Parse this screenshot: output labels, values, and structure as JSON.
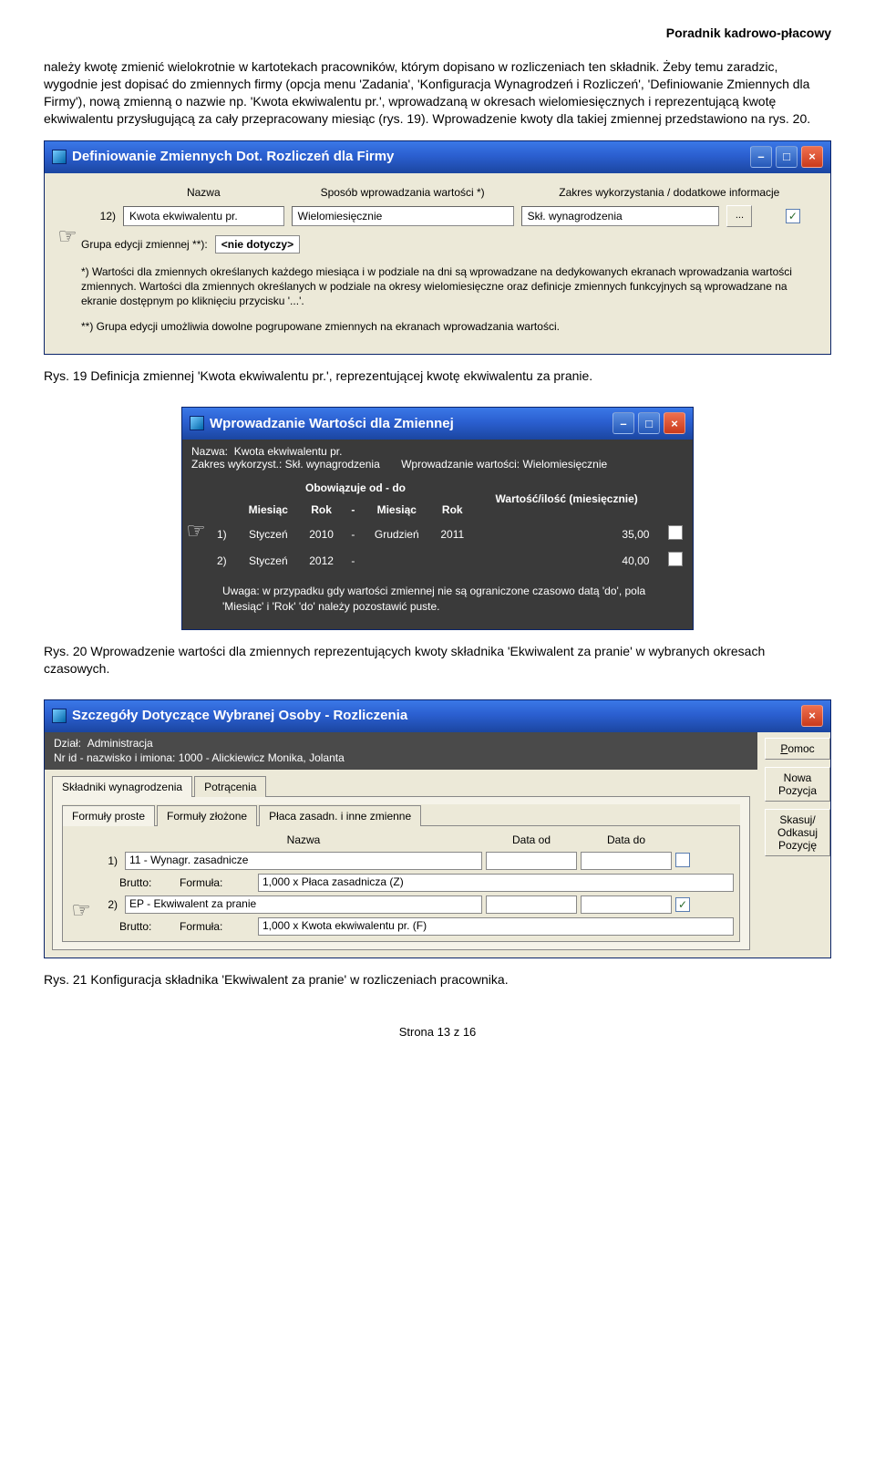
{
  "header": "Poradnik kadrowo-płacowy",
  "intro": "należy kwotę zmienić wielokrotnie w kartotekach pracowników, którym dopisano w rozliczeniach ten składnik. Żeby temu zaradzic, wygodnie jest dopisać do zmiennych firmy (opcja menu 'Zadania', 'Konfiguracja Wynagrodzeń i Rozliczeń', 'Definiowanie Zmiennych dla Firmy'), nową zmienną o nazwie np. 'Kwota ekwiwalentu pr.', wprowadzaną w okresach wielomiesięcznych i reprezentującą kwotę ekwiwalentu przysługującą za cały przepracowany miesiąc (rys. 19). Wprowadzenie kwoty dla takiej zmiennej przedstawiono na rys. 20.",
  "fig1": {
    "title": "Definiowanie Zmiennych Dot. Rozliczeń dla Firmy",
    "col_name": "Nazwa",
    "col_mode": "Sposób wprowadzania wartości *)",
    "col_scope": "Zakres wykorzystania / dodatkowe informacje",
    "row_idx": "12)",
    "row_name": "Kwota ekwiwalentu pr.",
    "row_mode": "Wielomiesięcznie",
    "row_scope": "Skł. wynagrodzenia",
    "row_btn": "...",
    "group_label": "Grupa edycji zmiennej **):",
    "group_value": "<nie dotyczy>",
    "note1": "*) Wartości dla zmiennych określanych każdego miesiąca i w podziale na dni są wprowadzane na dedykowanych ekranach wprowadzania wartości zmiennych. Wartości dla zmiennych określanych w podziale na okresy wielomiesięczne oraz definicje zmiennych funkcyjnych są wprowadzane na ekranie dostępnym po kliknięciu przycisku '...'.",
    "note2": "**) Grupa edycji umożliwia dowolne pogrupowane zmiennych na ekranach wprowadzania wartości."
  },
  "caption1": "Rys. 19 Definicja zmiennej 'Kwota ekwiwalentu pr.', reprezentującej kwotę ekwiwalentu za pranie.",
  "fig2": {
    "title": "Wprowadzanie Wartości dla Zmiennej",
    "name_label": "Nazwa:",
    "name_value": "Kwota ekwiwalentu pr.",
    "scope_label": "Zakres wykorzyst.: Skł. wynagrodzenia",
    "mode_label": "Wprowadzanie wartości: Wielomiesięcznie",
    "h_from": "Obowiązuje od - do",
    "h_mies1": "Miesiąc",
    "h_rok1": "Rok",
    "h_sep": "-",
    "h_mies2": "Miesiąc",
    "h_rok2": "Rok",
    "h_val": "Wartość/ilość (miesięcznie)",
    "r1_idx": "1)",
    "r1_m1": "Styczeń",
    "r1_y1": "2010",
    "r1_sep": "-",
    "r1_m2": "Grudzień",
    "r1_y2": "2011",
    "r1_val": "35,00",
    "r2_idx": "2)",
    "r2_m1": "Styczeń",
    "r2_y1": "2012",
    "r2_sep": "-",
    "r2_m2": "",
    "r2_y2": "",
    "r2_val": "40,00",
    "note": "Uwaga: w przypadku gdy wartości zmiennej nie są ograniczone czasowo datą 'do', pola 'Miesiąc' i 'Rok' 'do' należy pozostawić puste."
  },
  "caption2": "Rys. 20 Wprowadzenie wartości dla zmiennych reprezentujących kwoty składnika 'Ekwiwalent za pranie' w wybranych okresach czasowych.",
  "fig3": {
    "title": "Szczegóły Dotyczące Wybranej Osoby - Rozliczenia",
    "dept_label": "Dział:",
    "dept_value": "Administracja",
    "id_label": "Nr id - nazwisko i imiona: 1000 - Alickiewicz Monika, Jolanta",
    "tab_skladniki": "Składniki wynagrodzenia",
    "tab_potracenia": "Potrącenia",
    "subtab_proste": "Formuły proste",
    "subtab_zlozone": "Formuły złożone",
    "subtab_placa": "Płaca zasadn. i inne zmienne",
    "col_nazwa": "Nazwa",
    "col_dataod": "Data od",
    "col_datado": "Data do",
    "r1_idx": "1)",
    "r1_name": "11 - Wynagr. zasadnicze",
    "r1_brutto": "Brutto:",
    "r1_formula_lbl": "Formuła:",
    "r1_formula": "1,000 x Płaca zasadnicza (Z)",
    "r2_idx": "2)",
    "r2_name": "EP - Ekwiwalent za pranie",
    "r2_brutto": "Brutto:",
    "r2_formula_lbl": "Formuła:",
    "r2_formula": "1,000 x Kwota ekwiwalentu pr. (F)",
    "btn_pomoc": "Pomoc",
    "btn_nowa": "Nowa Pozycja",
    "btn_skasuj": "Skasuj/ Odkasuj Pozycję"
  },
  "caption3": "Rys. 21 Konfiguracja składnika 'Ekwiwalent za pranie' w rozliczeniach pracownika.",
  "footer": "Strona 13 z 16"
}
